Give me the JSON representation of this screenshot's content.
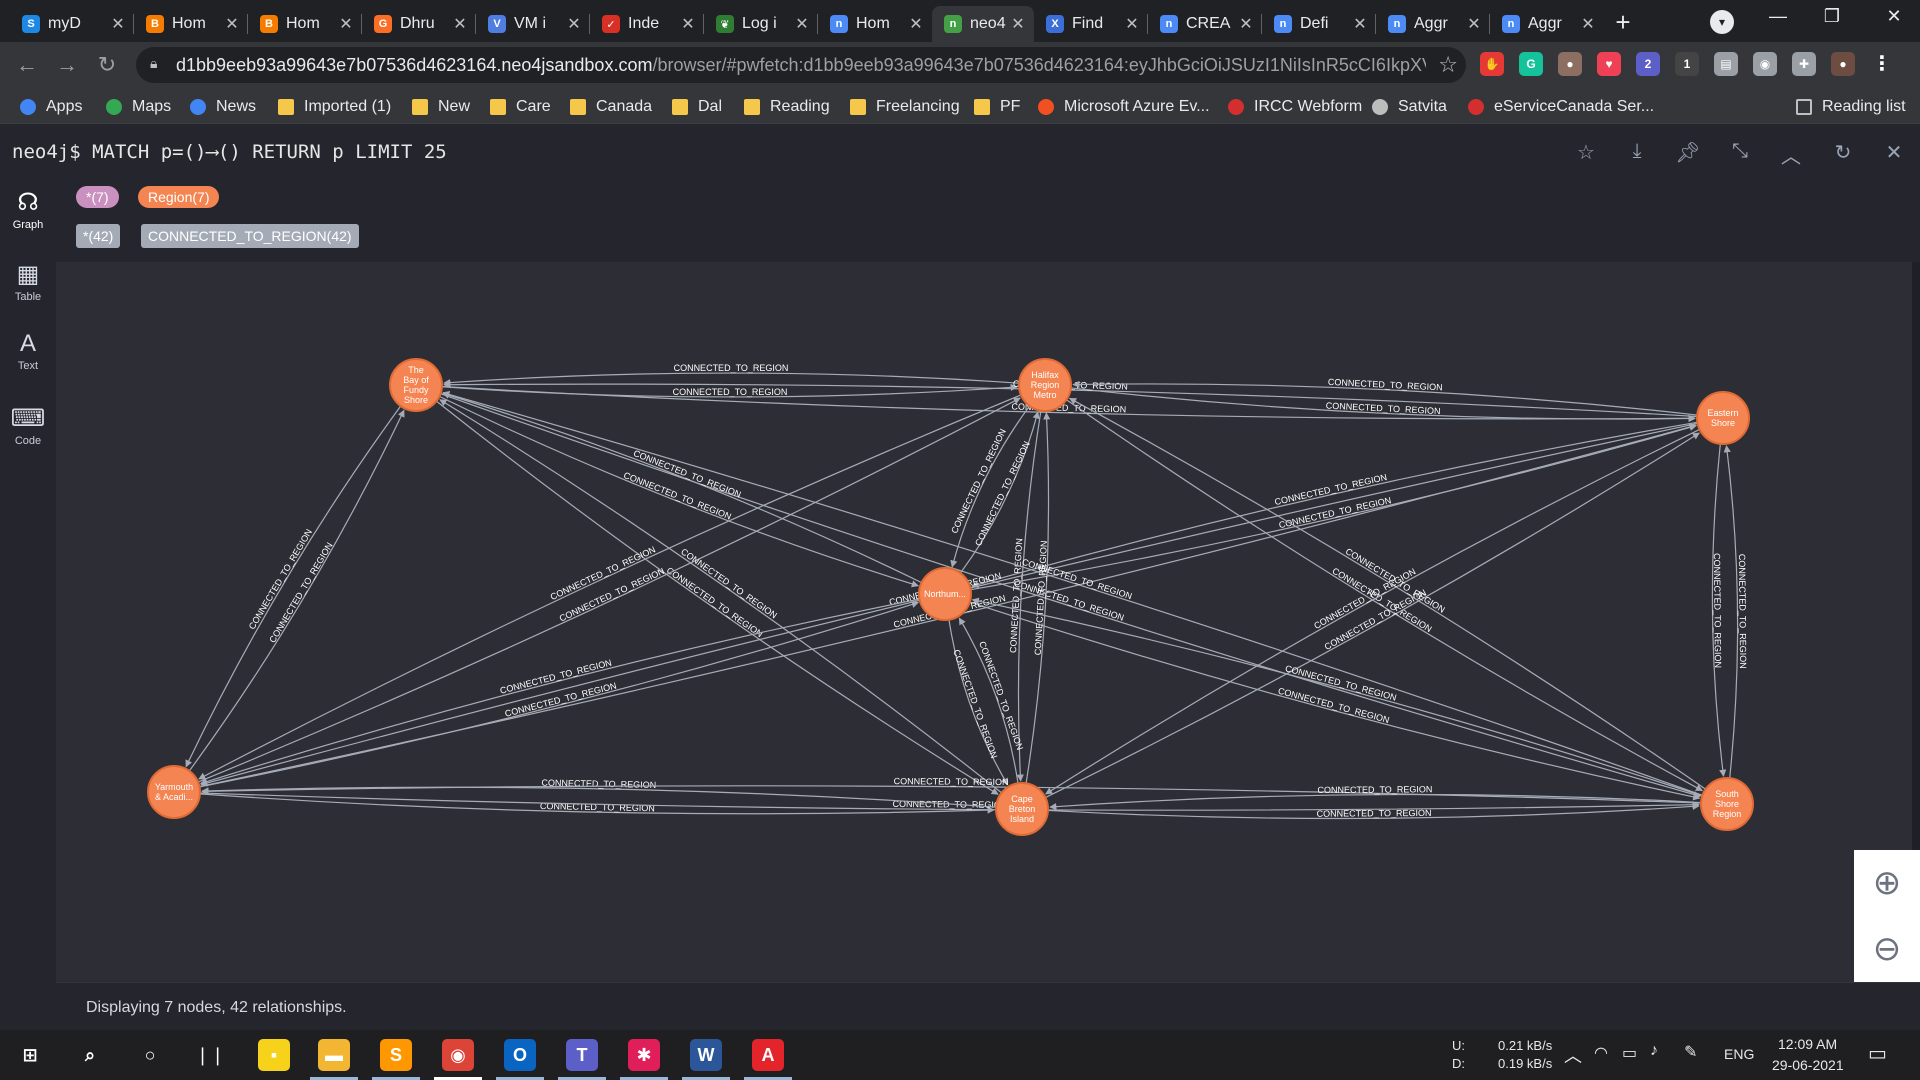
{
  "browser": {
    "tabs": [
      {
        "title": "myD",
        "icon": "salesforce-icon",
        "color": "#1e88e5",
        "glyph": "S"
      },
      {
        "title": "Hom",
        "icon": "blogger-icon",
        "color": "#f57c00",
        "glyph": "B"
      },
      {
        "title": "Hom",
        "icon": "blogger-icon",
        "color": "#f57c00",
        "glyph": "B"
      },
      {
        "title": "Dhru",
        "icon": "gitlab-icon",
        "color": "#fc6d26",
        "glyph": "G"
      },
      {
        "title": "VM i",
        "icon": "azure-vm-icon",
        "color": "#4f7de0",
        "glyph": "V"
      },
      {
        "title": "Inde",
        "icon": "quill-icon",
        "color": "#d93025",
        "glyph": "✓"
      },
      {
        "title": "Log i",
        "icon": "mongodb-icon",
        "color": "#2e7d32",
        "glyph": "❦"
      },
      {
        "title": "Hom",
        "icon": "neo4j-icon",
        "color": "#4c8bf5",
        "glyph": "n"
      },
      {
        "title": "neo4",
        "icon": "neo4j-icon",
        "color": "#43a047",
        "glyph": "n"
      },
      {
        "title": "Find",
        "icon": "gcp-icon",
        "color": "#3c6ed8",
        "glyph": "X"
      },
      {
        "title": "CREA",
        "icon": "neo4j-icon",
        "color": "#4c8bf5",
        "glyph": "n"
      },
      {
        "title": "Defi",
        "icon": "neo4j-icon",
        "color": "#4c8bf5",
        "glyph": "n"
      },
      {
        "title": "Aggr",
        "icon": "neo4j-icon",
        "color": "#4c8bf5",
        "glyph": "n"
      },
      {
        "title": "Aggr",
        "icon": "neo4j-icon",
        "color": "#4c8bf5",
        "glyph": "n"
      }
    ],
    "active_tab_index": 8,
    "url_host": "d1bb9eeb93a99643e7b07536d4623164.neo4jsandbox.com",
    "url_path": "/browser/#pwfetch:d1bb9eeb93a99643e7b07536d4623164:eyJhbGciOiJSUzI1NiIsInR5cCI6IkpXVCIsI...",
    "extensions": [
      {
        "name": "ad-block-icon",
        "color": "#e53935",
        "glyph": "✋"
      },
      {
        "name": "grammarly-icon",
        "color": "#15c39a",
        "glyph": "G"
      },
      {
        "name": "cookie-icon",
        "color": "#8d6e63",
        "glyph": "●"
      },
      {
        "name": "pocket-icon",
        "color": "#ef4056",
        "glyph": "♥"
      },
      {
        "name": "teams-ext-icon",
        "color": "#5b5fc7",
        "glyph": "2"
      },
      {
        "name": "tampermonkey-icon",
        "color": "#444",
        "glyph": "1"
      },
      {
        "name": "page-icon",
        "color": "#9aa0a6",
        "glyph": "▤"
      },
      {
        "name": "camera-icon",
        "color": "#9aa0a6",
        "glyph": "◉"
      },
      {
        "name": "puzzle-icon",
        "color": "#9aa0a6",
        "glyph": "✚"
      },
      {
        "name": "profile-avatar-icon",
        "color": "#6d4c41",
        "glyph": "●"
      },
      {
        "name": "menu-dots-icon",
        "color": "#35363a",
        "glyph": "⋮"
      }
    ],
    "bookmarks": [
      {
        "label": "Apps",
        "icon": "apps-grid-icon",
        "color": "#4285f4"
      },
      {
        "label": "Maps",
        "icon": "maps-pin-icon",
        "color": "#34a853"
      },
      {
        "label": "News",
        "icon": "news-icon",
        "color": "#4285f4"
      },
      {
        "label": "Imported (1)",
        "icon": "folder-icon",
        "color": "#f5c84b"
      },
      {
        "label": "New",
        "icon": "folder-icon",
        "color": "#f5c84b"
      },
      {
        "label": "Care",
        "icon": "folder-icon",
        "color": "#f5c84b"
      },
      {
        "label": "Canada",
        "icon": "folder-icon",
        "color": "#f5c84b"
      },
      {
        "label": "Dal",
        "icon": "folder-icon",
        "color": "#f5c84b"
      },
      {
        "label": "Reading",
        "icon": "folder-icon",
        "color": "#f5c84b"
      },
      {
        "label": "Freelancing",
        "icon": "folder-icon",
        "color": "#f5c84b"
      },
      {
        "label": "PF",
        "icon": "folder-icon",
        "color": "#f5c84b"
      },
      {
        "label": "Microsoft Azure Ev...",
        "icon": "microsoft-icon",
        "color": "#f25022"
      },
      {
        "label": "IRCC Webform",
        "icon": "maple-leaf-icon",
        "color": "#d32f2f"
      },
      {
        "label": "Satvita",
        "icon": "globe-icon",
        "color": "#bdbdbd"
      },
      {
        "label": "eServiceCanada Ser...",
        "icon": "maple-leaf-icon",
        "color": "#d32f2f"
      }
    ],
    "reading_list": "Reading list"
  },
  "neo4j": {
    "prompt": "neo4j$",
    "query": "MATCH p=()⟶() RETURN p LIMIT 25",
    "sidebar": [
      {
        "label": "Graph",
        "icon": "graph-icon",
        "glyph": "☊"
      },
      {
        "label": "Table",
        "icon": "table-icon",
        "glyph": "▦"
      },
      {
        "label": "Text",
        "icon": "text-icon",
        "glyph": "A"
      },
      {
        "label": "Code",
        "icon": "code-icon",
        "glyph": "⌨"
      }
    ],
    "legend": {
      "node_all": "*(7)",
      "node_label": "Region(7)",
      "node_all_color": "#c990c0",
      "node_label_color": "#f48451",
      "rel_all": "*(42)",
      "rel_type": "CONNECTED_TO_REGION(42)"
    },
    "status": "Displaying 7 nodes, 42 relationships.",
    "graph": {
      "nodes": [
        {
          "id": "bay",
          "label": [
            "The",
            "Bay of",
            "Fundy",
            "Shore"
          ]
        },
        {
          "id": "hal",
          "label": [
            "Halifax",
            "Region",
            "Metro"
          ]
        },
        {
          "id": "east",
          "label": [
            "Eastern",
            "Shore"
          ]
        },
        {
          "id": "north",
          "label": [
            "Northum..."
          ]
        },
        {
          "id": "yar",
          "label": [
            "Yarmouth",
            "& Acadi..."
          ]
        },
        {
          "id": "cape",
          "label": [
            "Cape",
            "Breton",
            "Island"
          ]
        },
        {
          "id": "south",
          "label": [
            "South",
            "Shore",
            "Region"
          ]
        }
      ],
      "rel_label": "CONNECTED_TO_REGION"
    }
  },
  "taskbar": {
    "apps": [
      {
        "name": "sticky-notes-icon",
        "color": "#f7d21a",
        "glyph": "▪"
      },
      {
        "name": "file-explorer-icon",
        "color": "#f2b632",
        "glyph": "▬"
      },
      {
        "name": "sublime-text-icon",
        "color": "#ff9800",
        "glyph": "S"
      },
      {
        "name": "chrome-icon",
        "color": "#db4437",
        "glyph": "◉"
      },
      {
        "name": "outlook-icon",
        "color": "#0a64c2",
        "glyph": "O"
      },
      {
        "name": "teams-icon",
        "color": "#5b5fc7",
        "glyph": "T"
      },
      {
        "name": "slack-icon",
        "color": "#e01e5a",
        "glyph": "✱"
      },
      {
        "name": "word-icon",
        "color": "#2b579a",
        "glyph": "W"
      },
      {
        "name": "acrobat-icon",
        "color": "#e3242b",
        "glyph": "A"
      }
    ],
    "net_up_label": "U:",
    "net_down_label": "D:",
    "net_up": "0.21 kB/s",
    "net_down": "0.19 kB/s",
    "lang": "ENG",
    "time": "12:09 AM",
    "date": "29-06-2021"
  }
}
